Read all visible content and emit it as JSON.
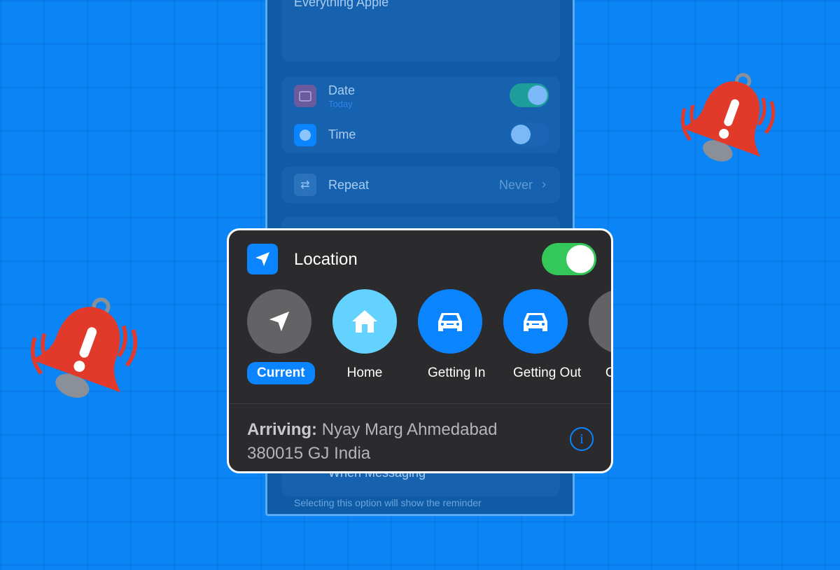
{
  "background": {
    "color": "#0b85f5"
  },
  "phone": {
    "notes_text": "Everything Apple",
    "date": {
      "label": "Date",
      "sub": "Today",
      "enabled": true
    },
    "time": {
      "label": "Time",
      "enabled": false
    },
    "repeat": {
      "label": "Repeat",
      "value": "Never"
    },
    "messaging": {
      "label": "When Messaging",
      "enabled": false
    },
    "footer": "Selecting this option will show the reminder"
  },
  "card": {
    "title": "Location",
    "enabled": true,
    "toggle_color": "#34c759",
    "options": [
      {
        "label": "Current",
        "icon": "location-arrow-icon",
        "selected": true,
        "color": "#636366"
      },
      {
        "label": "Home",
        "icon": "house-icon",
        "selected": false,
        "color": "#64d2ff"
      },
      {
        "label": "Getting In",
        "icon": "car-icon",
        "selected": false,
        "color": "#0a84ff"
      },
      {
        "label": "Getting Out",
        "icon": "car-icon",
        "selected": false,
        "color": "#0a84ff"
      },
      {
        "label": "Cu",
        "icon": "custom-icon",
        "selected": false,
        "color": "#636366"
      }
    ],
    "arriving_label": "Arriving:",
    "address_line1": "Nyay Marg Ahmedabad",
    "address_line2": "380015 GJ India",
    "info_glyph": "i"
  }
}
